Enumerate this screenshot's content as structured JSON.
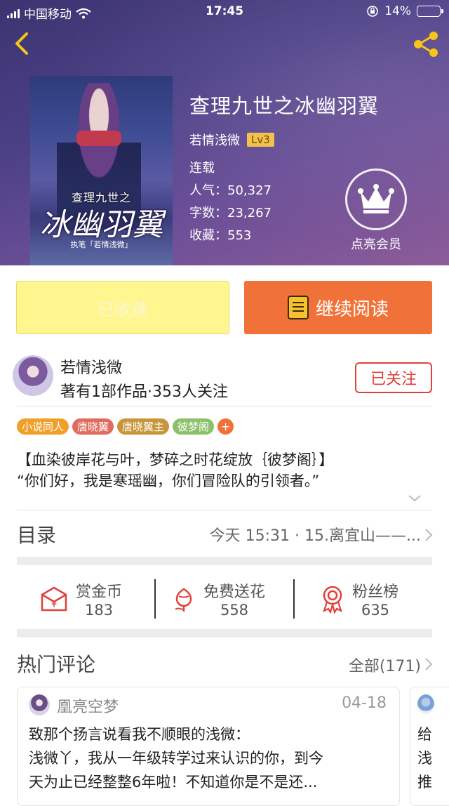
{
  "status_bar": {
    "carrier": "中国移动",
    "time": "17:45",
    "battery": "14%"
  },
  "book": {
    "cover": {
      "small_title": "查理九世之",
      "big_title": "冰幽羽翼",
      "author_note": "执笔「若情浅微」"
    },
    "title": "查理九世之冰幽羽翼",
    "author": "若情浅微",
    "level": "Lv3",
    "status": "连载",
    "popularity": "人气：50,327",
    "word_count": "字数：23,267",
    "favorites": "收藏：553",
    "vip_label": "点亮会员"
  },
  "actions": {
    "collected": "已收藏",
    "continue": "继续阅读"
  },
  "author_info": {
    "name": "若情浅微",
    "stats": "著有1部作品·353人关注",
    "follow_label": "已关注"
  },
  "tags": [
    {
      "label": "小说同人",
      "color": "#f0a02a"
    },
    {
      "label": "唐晓翼",
      "color": "#e06b5f"
    },
    {
      "label": "唐晓翼主",
      "color": "#c9953b"
    },
    {
      "label": "彼梦阁",
      "color": "#8cc06a"
    }
  ],
  "tag_more": "+",
  "description": {
    "line1": "【血染彼岸花与叶，梦碎之时花绽放｛彼梦阁｝】",
    "line2": "“你们好，我是寒瑶幽，你们冒险队的引领者。”"
  },
  "catalog": {
    "title": "目录",
    "latest": "今天 15:31 · 15.离宜山——..."
  },
  "stats": [
    {
      "label": "赏金币",
      "value": "183",
      "icon": "red-envelope-icon"
    },
    {
      "label": "免费送花",
      "value": "558",
      "icon": "flower-icon"
    },
    {
      "label": "粉丝榜",
      "value": "635",
      "icon": "medal-icon"
    }
  ],
  "comments_section": {
    "title": "热门评论",
    "all_label": "全部(171)"
  },
  "comment": {
    "user": "凰亮空梦",
    "date": "04-18",
    "line1": "致那个扬言说看我不顺眼的浅微：",
    "line2": "浅微丫，我从一年级转学过来认识的你，到今",
    "line3": "天为止已经整整6年啦！不知道你是不是还..."
  },
  "comment_next": {
    "line1": "给",
    "line2": "浅",
    "line3": "推"
  }
}
